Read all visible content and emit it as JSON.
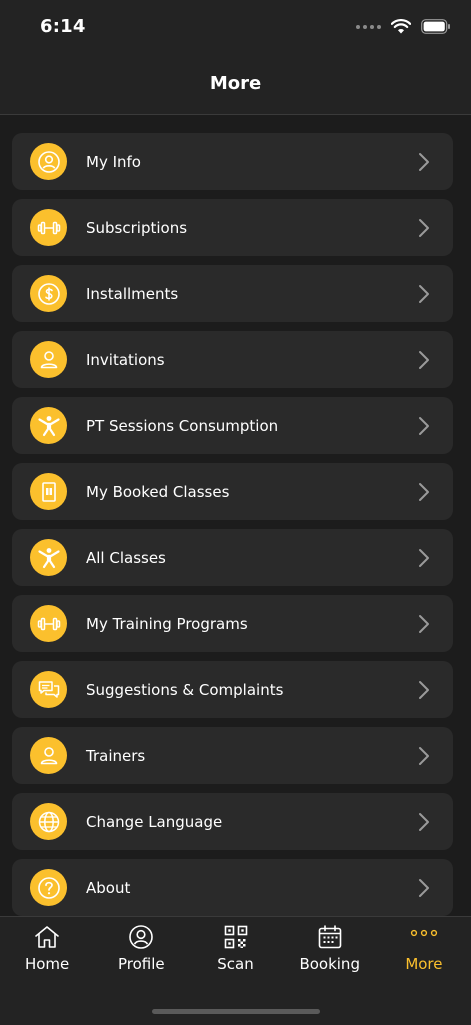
{
  "status": {
    "time": "6:14"
  },
  "header": {
    "title": "More"
  },
  "menu": [
    {
      "label": "My Info",
      "icon": "user-circle-icon"
    },
    {
      "label": "Subscriptions",
      "icon": "dumbbell-icon"
    },
    {
      "label": "Installments",
      "icon": "dollar-circle-icon"
    },
    {
      "label": "Invitations",
      "icon": "user-icon"
    },
    {
      "label": "PT Sessions Consumption",
      "icon": "stretch-person-icon"
    },
    {
      "label": "My Booked Classes",
      "icon": "booked-door-icon"
    },
    {
      "label": "All Classes",
      "icon": "stretch-person-icon"
    },
    {
      "label": "My Training Programs",
      "icon": "dumbbell-icon"
    },
    {
      "label": "Suggestions & Complaints",
      "icon": "chat-bubbles-icon"
    },
    {
      "label": "Trainers",
      "icon": "user-icon"
    },
    {
      "label": "Change Language",
      "icon": "globe-icon"
    },
    {
      "label": "About",
      "icon": "question-circle-icon"
    }
  ],
  "tabs": [
    {
      "label": "Home",
      "icon": "home-icon",
      "active": false
    },
    {
      "label": "Profile",
      "icon": "profile-icon",
      "active": false
    },
    {
      "label": "Scan",
      "icon": "qr-code-icon",
      "active": false
    },
    {
      "label": "Booking",
      "icon": "calendar-icon",
      "active": false
    },
    {
      "label": "More",
      "icon": "more-dots-icon",
      "active": true
    }
  ],
  "colors": {
    "accent": "#fbc02d",
    "background": "#1c1c1c",
    "card": "#2a2a2a",
    "bar": "#232323"
  }
}
